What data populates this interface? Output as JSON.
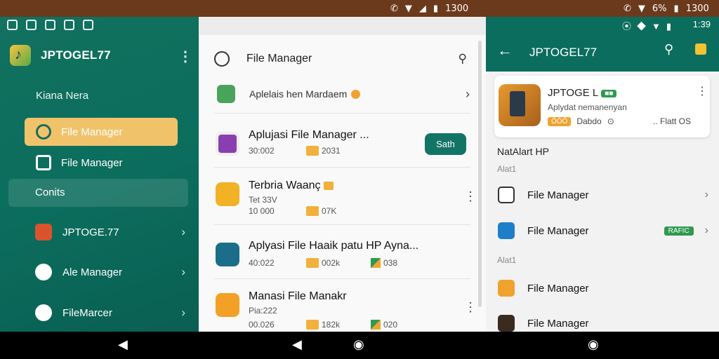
{
  "status_bar": {
    "middle_time": "1300",
    "middle_battery": "",
    "right_battery": "6%",
    "right_time": "1300"
  },
  "left": {
    "brand": "JPTOGEL77",
    "section_label": "Kiana Nera",
    "items": [
      {
        "label": "File Manager",
        "active": true,
        "icon": "magnifier-icon"
      },
      {
        "label": "File Manager",
        "active": false,
        "icon": "recycle-icon"
      }
    ],
    "group_label": "Conits",
    "nav": [
      {
        "label": "JPTOGE.77",
        "icon": "app-icon"
      },
      {
        "label": "Ale Manager",
        "icon": "globe-icon"
      },
      {
        "label": "FileMarcer",
        "icon": "bird-icon"
      }
    ]
  },
  "middle": {
    "title": "File Manager",
    "app_bar_text": "Aplelais hen Mardaem",
    "rows": [
      {
        "title": "Aplujasi File Manager ...",
        "sub": "",
        "meta1": "30:002",
        "meta2": "2031",
        "meta3": "",
        "button": "Sath"
      },
      {
        "title": "Terbria Waanç",
        "sub": "Tet 33V",
        "meta1": "10 000",
        "meta2": "07K",
        "meta3": "",
        "button": ""
      },
      {
        "title": "Aplyasi File Haaik patu HP Ayna...",
        "sub": "",
        "meta1": "40:022",
        "meta2": "002k",
        "meta3": "038",
        "button": ""
      },
      {
        "title": "Manasi File Manakr",
        "sub": "Pia:222",
        "meta1": "00.026",
        "meta2": "182k",
        "meta3": "020",
        "button": ""
      }
    ]
  },
  "right": {
    "title": "JPTOGEL77",
    "card": {
      "name": "JPTOGE L",
      "badge": "",
      "subtitle": "Aplydat nemanenyan",
      "pill": "ŌŌŌ",
      "rating_text": "Dabdo",
      "right_text": ".. Flatt  OS"
    },
    "section_title": "NatAlart HP",
    "section_small": "Alat1",
    "rows": [
      {
        "label": "File Manager",
        "pill": "",
        "icon_color": "#ffffff"
      },
      {
        "label": "File Manager",
        "pill": "RAFIC",
        "icon_color": "#1f7ec8"
      }
    ],
    "section_small2": "Alat1",
    "rows2": [
      {
        "label": "File Manager",
        "icon_color": "#f0a22e"
      },
      {
        "label": "File Manager",
        "icon_color": "#3a2a20"
      }
    ]
  },
  "nav": {
    "back": "◀",
    "home": "◉"
  }
}
